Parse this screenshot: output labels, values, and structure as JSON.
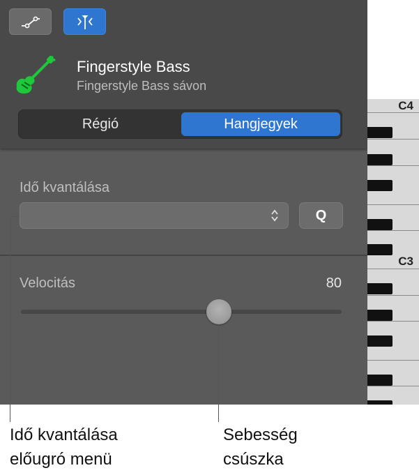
{
  "toolbar": {
    "curve_button_icon": "automation-curve-icon",
    "catch_button_icon": "catch-playhead-icon",
    "active_color": "#2f76d0"
  },
  "track": {
    "icon": "electric-bass-guitar-icon",
    "icon_color": "#1ec83a",
    "name": "Fingerstyle Bass",
    "subtitle": "Fingerstyle Bass sávon"
  },
  "segmented": {
    "tabs": [
      {
        "label": "Régió",
        "selected": false
      },
      {
        "label": "Hangjegyek",
        "selected": true
      }
    ]
  },
  "quantize": {
    "label": "Idő kvantálása",
    "value": "",
    "q_button": "Q"
  },
  "velocity": {
    "label": "Velocitás",
    "value": "80",
    "slider_fraction": 0.618
  },
  "piano": {
    "labels": [
      "C4",
      "C3"
    ]
  },
  "callouts": {
    "quantize_line1": "Idő kvantálása",
    "quantize_line2": "előugró menü",
    "velocity_line1": "Sebesség",
    "velocity_line2": "csúszka"
  }
}
